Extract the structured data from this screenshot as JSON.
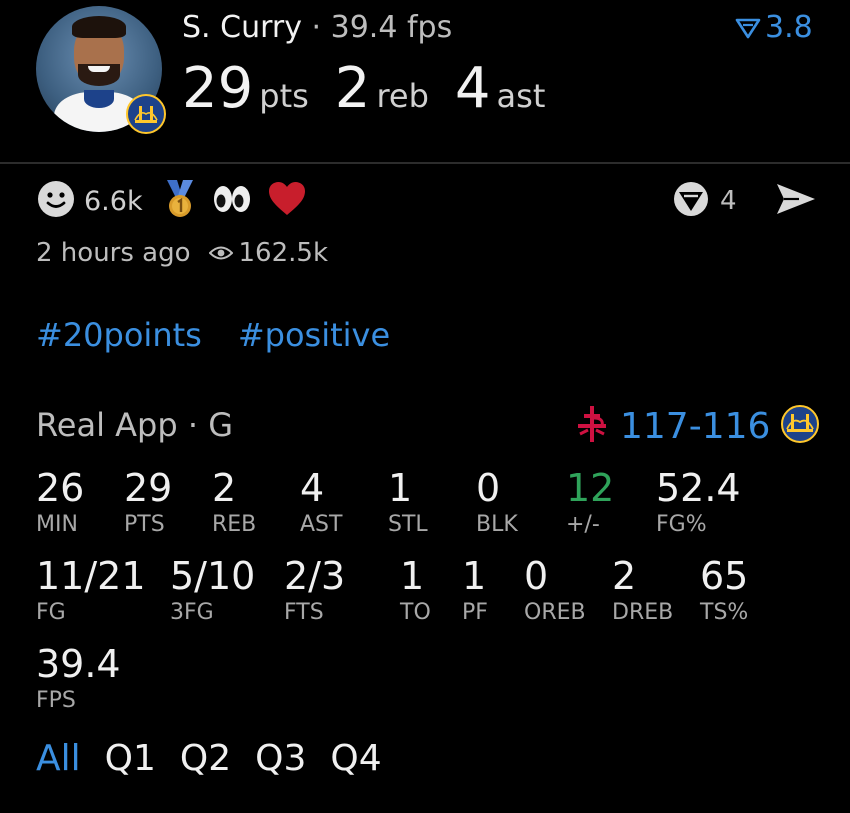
{
  "header": {
    "player_name": "S. Curry",
    "separator": "·",
    "fps": "39.4 fps",
    "rating": "3.8",
    "pts": "29",
    "pts_unit": "pts",
    "reb": "2",
    "reb_unit": "reb",
    "ast": "4",
    "ast_unit": "ast"
  },
  "reactions": {
    "smile_count": "6.6k",
    "share_count": "4"
  },
  "meta": {
    "time_ago": "2 hours ago",
    "views": "162.5k"
  },
  "tags": [
    "#20points",
    "#positive"
  ],
  "game": {
    "source": "Real App · G",
    "score": "117-116"
  },
  "stats_row1": [
    {
      "val": "26",
      "lbl": "MIN"
    },
    {
      "val": "29",
      "lbl": "PTS"
    },
    {
      "val": "2",
      "lbl": "REB"
    },
    {
      "val": "4",
      "lbl": "AST"
    },
    {
      "val": "1",
      "lbl": "STL"
    },
    {
      "val": "0",
      "lbl": "BLK"
    },
    {
      "val": "12",
      "lbl": "+/-"
    },
    {
      "val": "52.4",
      "lbl": "FG%"
    }
  ],
  "stats_row2": [
    {
      "val": "11/21",
      "lbl": "FG"
    },
    {
      "val": "5/10",
      "lbl": "3FG"
    },
    {
      "val": "2/3",
      "lbl": "FTS"
    },
    {
      "val": "1",
      "lbl": "TO"
    },
    {
      "val": "1",
      "lbl": "PF"
    },
    {
      "val": "0",
      "lbl": "OREB"
    },
    {
      "val": "2",
      "lbl": "DREB"
    },
    {
      "val": "65",
      "lbl": "TS%"
    }
  ],
  "stats_row3": [
    {
      "val": "39.4",
      "lbl": "FPS"
    }
  ],
  "quarters": [
    "All",
    "Q1",
    "Q2",
    "Q3",
    "Q4"
  ],
  "colors": {
    "accent": "#3b8fe0",
    "positive": "#2fa35a",
    "rockets_red": "#ce1141",
    "warriors_blue": "#1d428a",
    "warriors_gold": "#ffc72c",
    "heart": "#c81e2c"
  },
  "icons": [
    "player-avatar",
    "warriors-logo-icon",
    "rating-down-icon",
    "smile-icon",
    "medal-icon",
    "eyes-icon",
    "heart-icon",
    "share-count-icon",
    "send-icon",
    "eye-icon",
    "rockets-logo-icon"
  ]
}
